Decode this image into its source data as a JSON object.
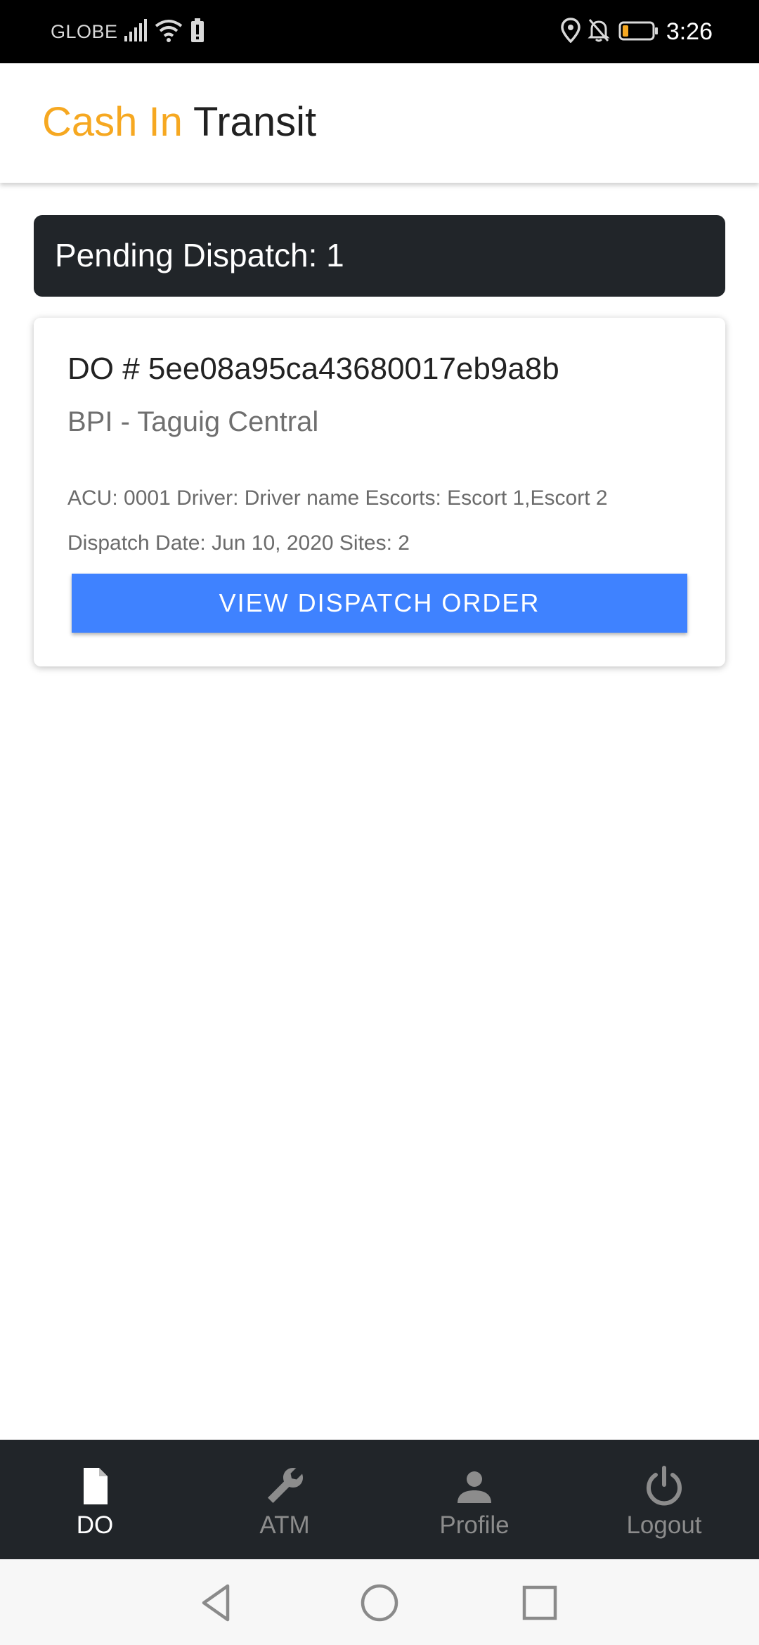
{
  "status_bar": {
    "carrier": "GLOBE",
    "time": "3:26",
    "icons": [
      "signal-icon",
      "wifi-icon",
      "battery-saver-icon",
      "location-icon",
      "notifications-off-icon",
      "battery-icon"
    ]
  },
  "app_bar": {
    "title_accent": "Cash In",
    "title_main": "Transit",
    "accent_color": "#f6a821"
  },
  "pending": {
    "label": "Pending Dispatch: 1"
  },
  "order_card": {
    "do_number": "DO # 5ee08a95ca43680017eb9a8b",
    "site": "BPI - Taguig Central",
    "meta_line1": "ACU: 0001 Driver: Driver name Escorts: Escort 1,Escort 2",
    "meta_line2": "Dispatch Date: Jun 10, 2020 Sites: 2",
    "button_label": "VIEW DISPATCH ORDER",
    "button_color": "#3f82ff"
  },
  "bottom_nav": {
    "items": [
      {
        "label": "DO",
        "icon": "document-icon",
        "active": true
      },
      {
        "label": "ATM",
        "icon": "wrench-icon",
        "active": false
      },
      {
        "label": "Profile",
        "icon": "person-icon",
        "active": false
      },
      {
        "label": "Logout",
        "icon": "power-icon",
        "active": false
      }
    ]
  },
  "system_nav": {
    "icons": [
      "back-icon",
      "home-icon",
      "recents-icon"
    ]
  }
}
